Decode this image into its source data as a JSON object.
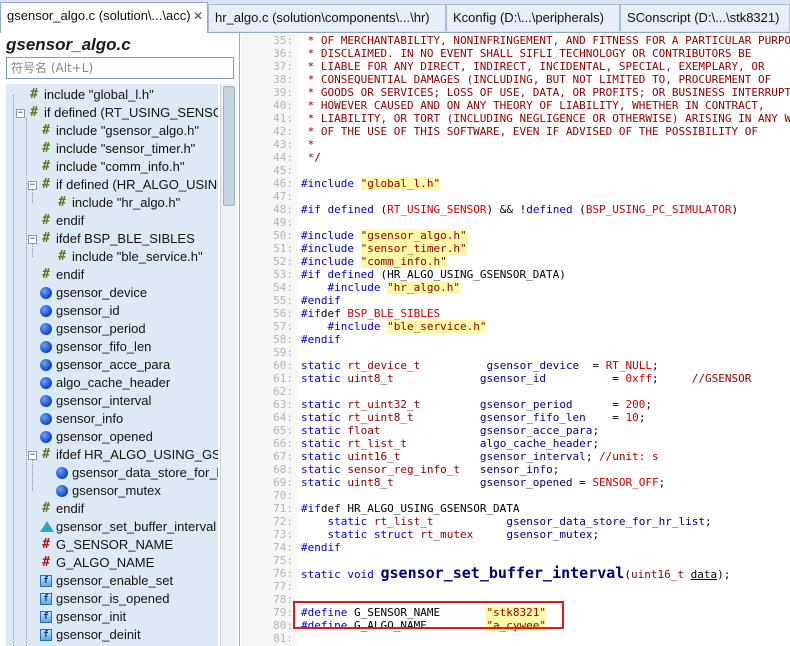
{
  "tabs": [
    {
      "label": "gsensor_algo.c (solution\\...\\acc)",
      "active": true,
      "close": "✕"
    },
    {
      "label": "hr_algo.c (solution\\components\\...\\hr)",
      "active": false
    },
    {
      "label": "Kconfig (D:\\...\\peripherals)",
      "active": false
    },
    {
      "label": "SConscript (D:\\...\\stk8321)",
      "active": false
    }
  ],
  "left_panel": {
    "file_title": "gsensor_algo.c",
    "search_placeholder": "符号名 (Alt+L)"
  },
  "outline": [
    {
      "label": "include \"global_l.h\"",
      "icon": "include-icon",
      "depth": 0
    },
    {
      "label": "if defined (RT_USING_SENSOR)",
      "icon": "include-icon",
      "depth": 0,
      "expander": "−"
    },
    {
      "label": "include \"gsensor_algo.h\"",
      "icon": "include-icon",
      "depth": 1
    },
    {
      "label": "include \"sensor_timer.h\"",
      "icon": "include-icon",
      "depth": 1
    },
    {
      "label": "include \"comm_info.h\"",
      "icon": "include-icon",
      "depth": 1
    },
    {
      "label": "if defined (HR_ALGO_USING_",
      "icon": "include-icon",
      "depth": 1,
      "expander": "−"
    },
    {
      "label": "include \"hr_algo.h\"",
      "icon": "include-icon",
      "depth": 2
    },
    {
      "label": "endif",
      "icon": "include-icon",
      "depth": 1
    },
    {
      "label": "ifdef BSP_BLE_SIBLES",
      "icon": "include-icon",
      "depth": 1,
      "expander": "−"
    },
    {
      "label": "include \"ble_service.h\"",
      "icon": "include-icon",
      "depth": 2
    },
    {
      "label": "endif",
      "icon": "include-icon",
      "depth": 1
    },
    {
      "label": "gsensor_device",
      "icon": "variable-icon",
      "depth": 1
    },
    {
      "label": "gsensor_id",
      "icon": "variable-icon",
      "depth": 1
    },
    {
      "label": "gsensor_period",
      "icon": "variable-icon",
      "depth": 1
    },
    {
      "label": "gsensor_fifo_len",
      "icon": "variable-icon",
      "depth": 1
    },
    {
      "label": "gsensor_acce_para",
      "icon": "variable-icon",
      "depth": 1
    },
    {
      "label": "algo_cache_header",
      "icon": "variable-icon",
      "depth": 1
    },
    {
      "label": "gsensor_interval",
      "icon": "variable-icon",
      "depth": 1
    },
    {
      "label": "sensor_info",
      "icon": "variable-icon",
      "depth": 1
    },
    {
      "label": "gsensor_opened",
      "icon": "variable-icon",
      "depth": 1
    },
    {
      "label": "ifdef HR_ALGO_USING_GSEN",
      "icon": "include-icon",
      "depth": 1,
      "expander": "−"
    },
    {
      "label": "gsensor_data_store_for_hr",
      "icon": "variable-icon",
      "depth": 2
    },
    {
      "label": "gsensor_mutex",
      "icon": "variable-icon",
      "depth": 2
    },
    {
      "label": "endif",
      "icon": "include-icon",
      "depth": 1
    },
    {
      "label": "gsensor_set_buffer_interval",
      "icon": "function-prototype-icon",
      "depth": 1
    },
    {
      "label": "G_SENSOR_NAME",
      "icon": "define-icon",
      "depth": 1
    },
    {
      "label": "G_ALGO_NAME",
      "icon": "define-icon",
      "depth": 1
    },
    {
      "label": "gsensor_enable_set",
      "icon": "function-icon",
      "depth": 1
    },
    {
      "label": "gsensor_is_opened",
      "icon": "function-icon",
      "depth": 1
    },
    {
      "label": "gsensor_init",
      "icon": "function-icon",
      "depth": 1
    },
    {
      "label": "gsensor_deinit",
      "icon": "function-icon",
      "depth": 1
    }
  ],
  "editor": {
    "lines": [
      {
        "n": "35:",
        "code": " * OF MERCHANTABILITY, NONINFRINGEMENT, AND FITNESS FOR A PARTICULAR PURPOSE"
      },
      {
        "n": "36:",
        "code": " * DISCLAIMED. IN NO EVENT SHALL SIFLI TECHNOLOGY OR CONTRIBUTORS BE"
      },
      {
        "n": "37:",
        "code": " * LIABLE FOR ANY DIRECT, INDIRECT, INCIDENTAL, SPECIAL, EXEMPLARY, OR"
      },
      {
        "n": "38:",
        "code": " * CONSEQUENTIAL DAMAGES (INCLUDING, BUT NOT LIMITED TO, PROCUREMENT OF"
      },
      {
        "n": "39:",
        "code": " * GOODS OR SERVICES; LOSS OF USE, DATA, OR PROFITS; OR BUSINESS INTERRUPTION)"
      },
      {
        "n": "40:",
        "code": " * HOWEVER CAUSED AND ON ANY THEORY OF LIABILITY, WHETHER IN CONTRACT,"
      },
      {
        "n": "41:",
        "code": " * LIABILITY, OR TORT (INCLUDING NEGLIGENCE OR OTHERWISE) ARISING IN ANY WAY"
      },
      {
        "n": "42:",
        "code": " * OF THE USE OF THIS SOFTWARE, EVEN IF ADVISED OF THE POSSIBILITY OF"
      },
      {
        "n": "43:",
        "code": " *"
      },
      {
        "n": "44:",
        "code": " */"
      },
      {
        "n": "45:",
        "code": ""
      },
      {
        "n": "46:",
        "code": "#include \"global_l.h\""
      },
      {
        "n": "47:",
        "code": ""
      },
      {
        "n": "48:",
        "code": "#if defined (RT_USING_SENSOR) && !defined (BSP_USING_PC_SIMULATOR)"
      },
      {
        "n": "49:",
        "code": ""
      },
      {
        "n": "50:",
        "code": "#include \"gsensor_algo.h\""
      },
      {
        "n": "51:",
        "code": "#include \"sensor_timer.h\""
      },
      {
        "n": "52:",
        "code": "#include \"comm_info.h\""
      },
      {
        "n": "53:",
        "code": "#if defined (HR_ALGO_USING_GSENSOR_DATA)"
      },
      {
        "n": "54:",
        "code": "    #include \"hr_algo.h\""
      },
      {
        "n": "55:",
        "code": "#endif"
      },
      {
        "n": "56:",
        "code": "#ifdef BSP_BLE_SIBLES"
      },
      {
        "n": "57:",
        "code": "    #include \"ble_service.h\""
      },
      {
        "n": "58:",
        "code": "#endif"
      },
      {
        "n": "59:",
        "code": ""
      },
      {
        "n": "60:",
        "code": "static rt_device_t          gsensor_device  = RT_NULL;"
      },
      {
        "n": "61:",
        "code": "static uint8_t             gsensor_id          = 0xff;     //GSENSOR"
      },
      {
        "n": "62:",
        "code": ""
      },
      {
        "n": "63:",
        "code": "static rt_uint32_t         gsensor_period      = 200;"
      },
      {
        "n": "64:",
        "code": "static rt_uint8_t          gsensor_fifo_len    = 10;"
      },
      {
        "n": "65:",
        "code": "static float               gsensor_acce_para;"
      },
      {
        "n": "66:",
        "code": "static rt_list_t           algo_cache_header;"
      },
      {
        "n": "67:",
        "code": "static uint16_t            gsensor_interval; //unit: s"
      },
      {
        "n": "68:",
        "code": "static sensor_reg_info_t   sensor_info;"
      },
      {
        "n": "69:",
        "code": "static uint8_t             gsensor_opened = SENSOR_OFF;"
      },
      {
        "n": "70:",
        "code": ""
      },
      {
        "n": "71:",
        "code": "#ifdef HR_ALGO_USING_GSENSOR_DATA"
      },
      {
        "n": "72:",
        "code": "    static rt_list_t           gsensor_data_store_for_hr_list;"
      },
      {
        "n": "73:",
        "code": "    static struct rt_mutex     gsensor_mutex;"
      },
      {
        "n": "74:",
        "code": "#endif"
      },
      {
        "n": "75:",
        "code": ""
      },
      {
        "n": "76:",
        "code": "static void gsensor_set_buffer_interval(uint16_t data);"
      },
      {
        "n": "77:",
        "code": ""
      },
      {
        "n": "78:",
        "code": ""
      },
      {
        "n": "79:",
        "code": "#define G_SENSOR_NAME       \"stk8321\""
      },
      {
        "n": "80:",
        "code": "#define G_ALGO_NAME         \"a_cywee\""
      },
      {
        "n": "81:",
        "code": ""
      }
    ]
  },
  "colors": {
    "comment": "#8e0000",
    "preprocessor": "#0000cc",
    "string_highlight": "#fff9a8",
    "identifier": "#00007a",
    "number": "#cc0000",
    "annotation_box": "#d62020",
    "outline_bg": "#ddeaf6"
  }
}
